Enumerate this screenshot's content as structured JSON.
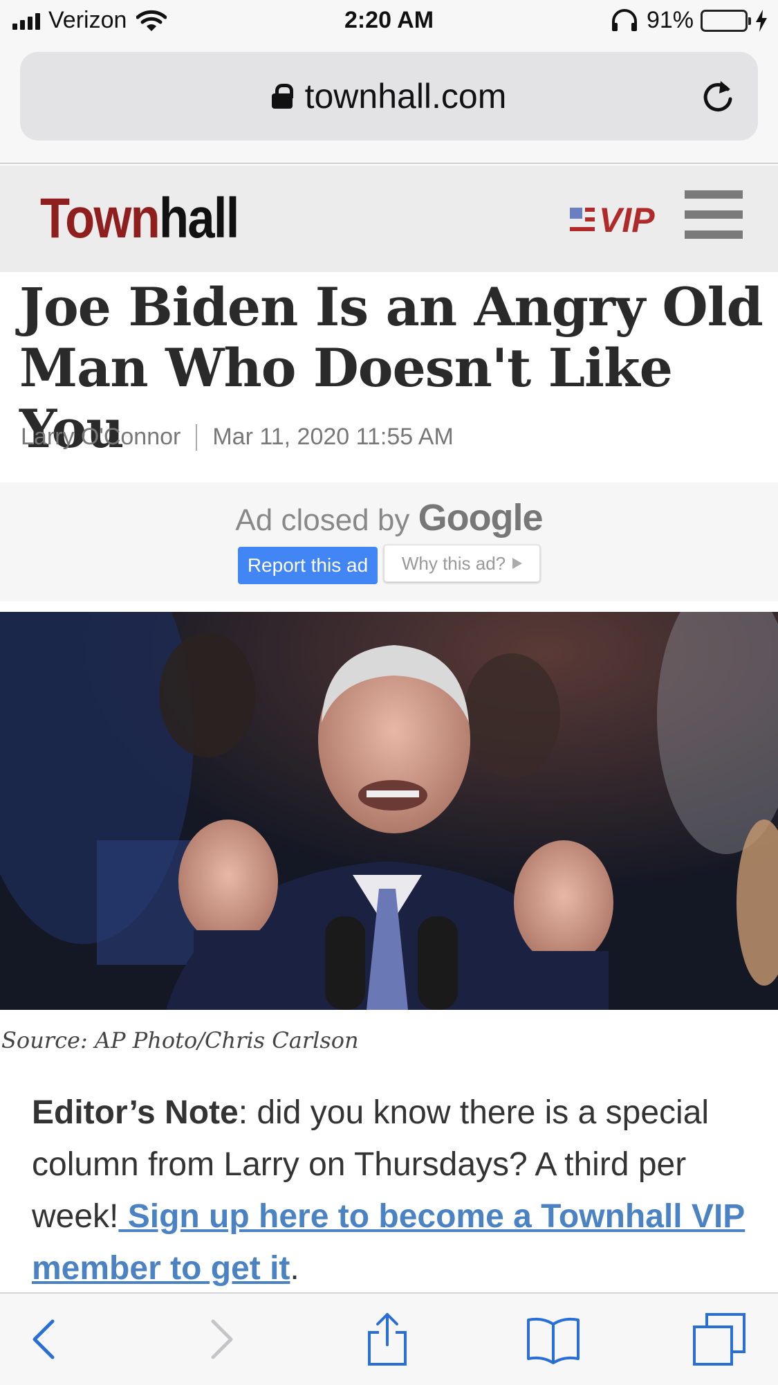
{
  "status_bar": {
    "carrier": "Verizon",
    "time": "2:20 AM",
    "battery_percent": "91%",
    "battery_level": 0.91
  },
  "browser": {
    "url": "townhall.com"
  },
  "site": {
    "logo_part1": "Town",
    "logo_part2": "hall",
    "vip_label": "VIP"
  },
  "article": {
    "headline": "Joe Biden Is an Angry Old Man Who Doesn't Like You",
    "author": "Larry O'Connor",
    "date": "Mar 11, 2020 11:55 AM",
    "image_caption": "Source: AP Photo/Chris Carlson",
    "editor_note_label": "Editor’s Note",
    "editor_note_text": ": did you know there is a special column from Larry on Thursdays? A third per week!",
    "signup_link": " Sign up here to become a Townhall VIP member to get it",
    "trailing": "."
  },
  "ad": {
    "closed_text": "Ad closed by",
    "closed_brand": "Google",
    "report_button": "Report this ad",
    "why_button": "Why this ad?"
  },
  "colors": {
    "brand_red": "#8f1f1f",
    "link_blue": "#4a82c4",
    "ios_blue": "#2a6fd6",
    "google_blue": "#4285f4"
  }
}
